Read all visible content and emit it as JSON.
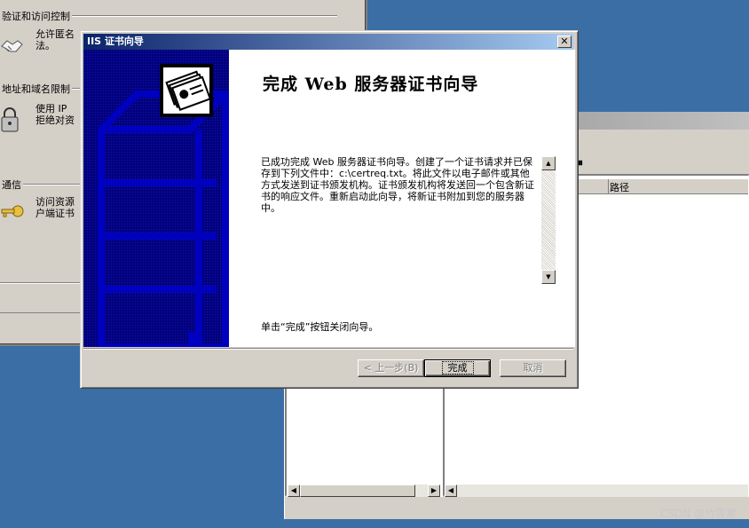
{
  "background_properties": {
    "section_auth": "验证和访问控制",
    "auth_text_line1": "允许匿名",
    "auth_text_line2": "法。",
    "section_ip": "地址和域名限制",
    "ip_text_line1": "使用 IP",
    "ip_text_line2": "拒绝对资",
    "section_secure": "通信",
    "secure_text_line1": "访问资源",
    "secure_text_line2": "户端证书"
  },
  "background_mmc": {
    "column_path": "路径",
    "toolbar_pause": "⏸"
  },
  "wizard": {
    "title": "IIS 证书向导",
    "heading": "完成 Web 服务器证书向导",
    "body": "已成功完成 Web 服务器证书向导。创建了一个证书请求并已保存到下列文件中：c:\\certreq.txt。将此文件以电子邮件或其他方式发送到证书颁发机构。证书颁发机构将发送回一个包含新证书的响应文件。重新启动此向导，将新证书附加到您的服务器中。",
    "finish_note": "单击“完成”按钮关闭向导。",
    "back_button": "< 上一步(B)",
    "finish_button": "完成",
    "cancel_button": "取消",
    "close_glyph": "✕"
  },
  "watermark": "CSDN @竹等寒",
  "colors": {
    "desktop": "#3a6ea5",
    "title_start": "#0a246a",
    "title_end": "#a6caf0",
    "side_panel": "#000080"
  }
}
